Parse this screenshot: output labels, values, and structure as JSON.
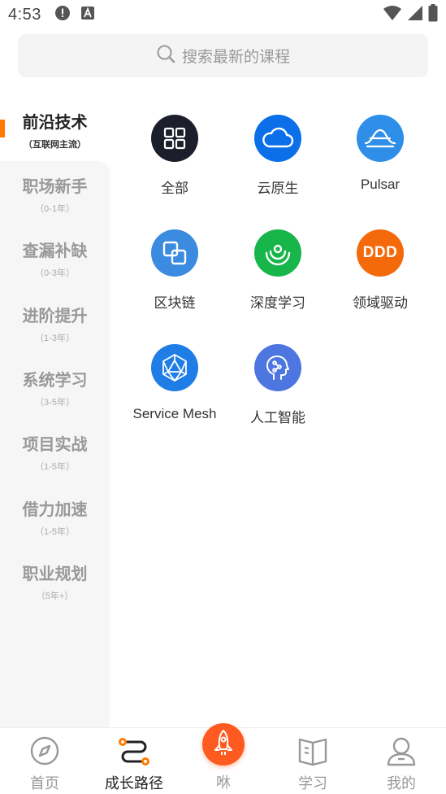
{
  "status": {
    "time": "4:53"
  },
  "search": {
    "placeholder": "搜索最新的课程"
  },
  "sidebar": {
    "items": [
      {
        "title": "前沿技术",
        "sub": "（互联网主流）"
      },
      {
        "title": "职场新手",
        "sub": "（0-1年）"
      },
      {
        "title": "查漏补缺",
        "sub": "（0-3年）"
      },
      {
        "title": "进阶提升",
        "sub": "（1-3年）"
      },
      {
        "title": "系统学习",
        "sub": "（3-5年）"
      },
      {
        "title": "项目实战",
        "sub": "（1-5年）"
      },
      {
        "title": "借力加速",
        "sub": "（1-5年）"
      },
      {
        "title": "职业规划",
        "sub": "（5年+）"
      }
    ]
  },
  "categories": [
    {
      "label": "全部",
      "icon": "grid-icon",
      "color": "#1c1f2b"
    },
    {
      "label": "云原生",
      "icon": "cloud-icon",
      "color": "#0a6fe8"
    },
    {
      "label": "Pulsar",
      "icon": "pulsar-icon",
      "color": "#2f8fe8"
    },
    {
      "label": "区块链",
      "icon": "blockchain-icon",
      "color": "#3b8be0"
    },
    {
      "label": "深度学习",
      "icon": "deep-learning-icon",
      "color": "#17b54a"
    },
    {
      "label": "领域驱动",
      "icon": "ddd-icon",
      "color": "#f46a0a",
      "text": "DDD"
    },
    {
      "label": "Service Mesh",
      "icon": "service-mesh-icon",
      "color": "#1f7de6"
    },
    {
      "label": "人工智能",
      "icon": "ai-brain-icon",
      "color": "#4d76e0"
    }
  ],
  "bottom_nav": {
    "home": "首页",
    "path": "成长路径",
    "center": "咻",
    "study": "学习",
    "mine": "我的"
  },
  "colors": {
    "accent": "#ff7a00",
    "rocket": "#ff5a1f"
  }
}
